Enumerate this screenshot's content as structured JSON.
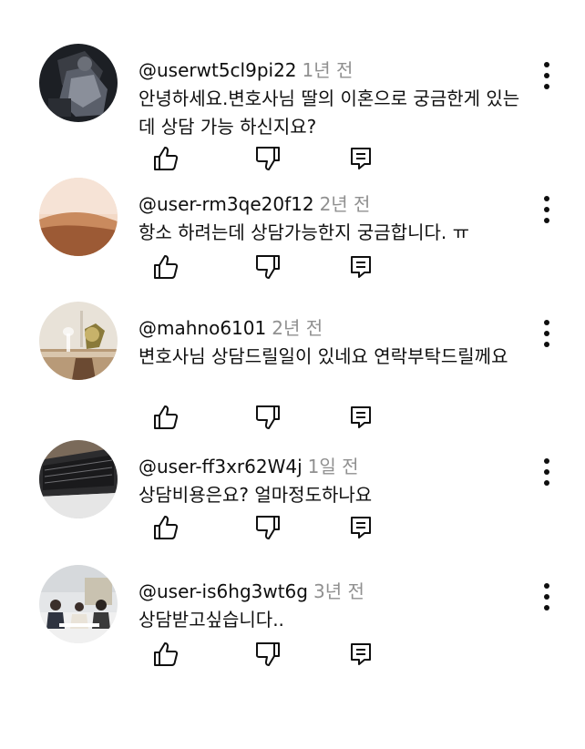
{
  "comments": [
    {
      "author": "@userwt5cl9pi22",
      "time": "1년 전",
      "text": "안녕하세요.변호사님 딸의 이혼으로 궁금한게 있는데 상담 가능 하신지요?"
    },
    {
      "author": "@user-rm3qe20f12",
      "time": "2년 전",
      "text": "항소 하려는데 상담가능한지 궁금합니다. ㅠ"
    },
    {
      "author": "@mahno6101",
      "time": "2년 전",
      "text": "변호사님 상담드릴일이 있네요 연락부탁드릴께요"
    },
    {
      "author": "@user-ff3xr62W4j",
      "time": "1일 전",
      "text": "상담비용은요? 얼마정도하나요"
    },
    {
      "author": "@user-is6hg3wt6g",
      "time": "3년 전",
      "text": "상담받고싶습니다.."
    }
  ],
  "icons": {
    "like": "thumb-up-icon",
    "dislike": "thumb-down-icon",
    "reply": "comment-reply-icon",
    "more": "more-vertical-icon"
  },
  "colors": {
    "text": "#0f0f0f",
    "time": "#909090",
    "background": "#ffffff"
  }
}
